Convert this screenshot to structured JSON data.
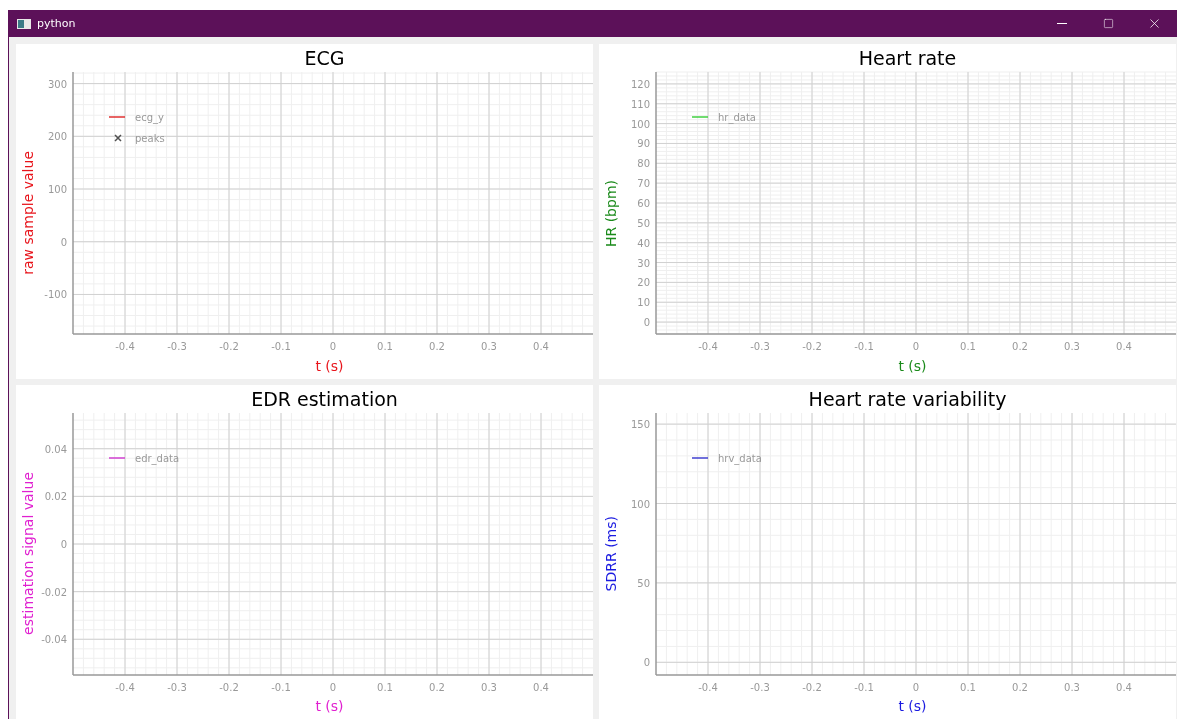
{
  "window": {
    "title": "python"
  },
  "panels": [
    {
      "color": "#e8141b",
      "chart_data": {
        "type": "line",
        "title": "ECG",
        "xlabel": "t (s)",
        "ylabel": "raw sample value",
        "grid": true,
        "categories": [
          "-0.4",
          "-0.3",
          "-0.2",
          "-0.1",
          "0",
          "0.1",
          "0.2",
          "0.3",
          "0.4"
        ],
        "ylim": [
          -175,
          322
        ],
        "yticks": [
          -100,
          0,
          100,
          200,
          300
        ],
        "series": [
          {
            "name": "ecg_y",
            "color": "#e03030",
            "values": [
              null,
              null,
              null,
              null,
              null,
              null,
              null,
              null,
              null
            ]
          },
          {
            "name": "peaks",
            "color": "#505050",
            "type": "scatter",
            "values": [
              null,
              null,
              null,
              null,
              null,
              null,
              null,
              null,
              null
            ]
          }
        ]
      }
    },
    {
      "color": "#1a8a1a",
      "chart_data": {
        "type": "line",
        "title": "Heart rate",
        "xlabel": "t (s)",
        "ylabel": "HR (bpm)",
        "grid": true,
        "categories": [
          "-0.4",
          "-0.3",
          "-0.2",
          "-0.1",
          "0",
          "0.1",
          "0.2",
          "0.3",
          "0.4"
        ],
        "ylim": [
          -6,
          126
        ],
        "yticks": [
          0,
          10,
          20,
          30,
          40,
          50,
          60,
          70,
          80,
          90,
          100,
          110,
          120
        ],
        "series": [
          {
            "name": "hr_data",
            "color": "#40d040",
            "values": [
              null,
              null,
              null,
              null,
              null,
              null,
              null,
              null,
              null
            ]
          }
        ]
      }
    },
    {
      "color": "#e020d0",
      "chart_data": {
        "type": "line",
        "title": "EDR estimation",
        "xlabel": "t (s)",
        "ylabel": "estimation signal value",
        "grid": true,
        "categories": [
          "-0.4",
          "-0.3",
          "-0.2",
          "-0.1",
          "0",
          "0.1",
          "0.2",
          "0.3",
          "0.4"
        ],
        "ylim": [
          -0.055,
          0.055
        ],
        "yticks": [
          -0.04,
          -0.02,
          0,
          0.02,
          0.04
        ],
        "series": [
          {
            "name": "edr_data",
            "color": "#d040d0",
            "values": [
              null,
              null,
              null,
              null,
              null,
              null,
              null,
              null,
              null
            ]
          }
        ]
      }
    },
    {
      "color": "#1a1ae0",
      "chart_data": {
        "type": "line",
        "title": "Heart rate variability",
        "xlabel": "t (s)",
        "ylabel": "SDRR (ms)",
        "grid": true,
        "categories": [
          "-0.4",
          "-0.3",
          "-0.2",
          "-0.1",
          "0",
          "0.1",
          "0.2",
          "0.3",
          "0.4"
        ],
        "ylim": [
          -8,
          157
        ],
        "yticks": [
          0,
          50,
          100,
          150
        ],
        "series": [
          {
            "name": "hrv_data",
            "color": "#4040d0",
            "values": [
              null,
              null,
              null,
              null,
              null,
              null,
              null,
              null,
              null
            ]
          }
        ]
      }
    }
  ]
}
